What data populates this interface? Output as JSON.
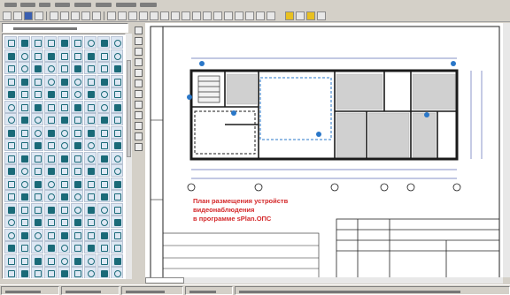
{
  "note": {
    "line1": "План размещения устройств",
    "line2": "видеонаблюдения",
    "line3": "в программе sPlan.ОПС"
  },
  "colors": {
    "note_text": "#d4282a",
    "plan_walls": "#1a1a1a",
    "dimension_lines": "#5b6bb5",
    "cameras": "#2a77c8",
    "library_symbols": "#1a6a78",
    "window_bg": "#d4d0c8"
  },
  "icons": {
    "toolbar": [
      "new-icon",
      "open-icon",
      "save-icon",
      "print-icon",
      "cut-icon",
      "copy-icon",
      "paste-icon",
      "undo-icon",
      "redo-icon",
      "zoom-icon",
      "grid-icon",
      "snap-icon",
      "color-icon",
      "layer-icon"
    ],
    "vertical_tools": [
      "pointer-icon",
      "line-icon",
      "rectangle-icon",
      "ellipse-icon",
      "arc-icon",
      "polyline-icon",
      "text-icon",
      "dimension-icon",
      "hatch-icon",
      "image-icon",
      "rotate-icon",
      "mirror-icon"
    ]
  }
}
